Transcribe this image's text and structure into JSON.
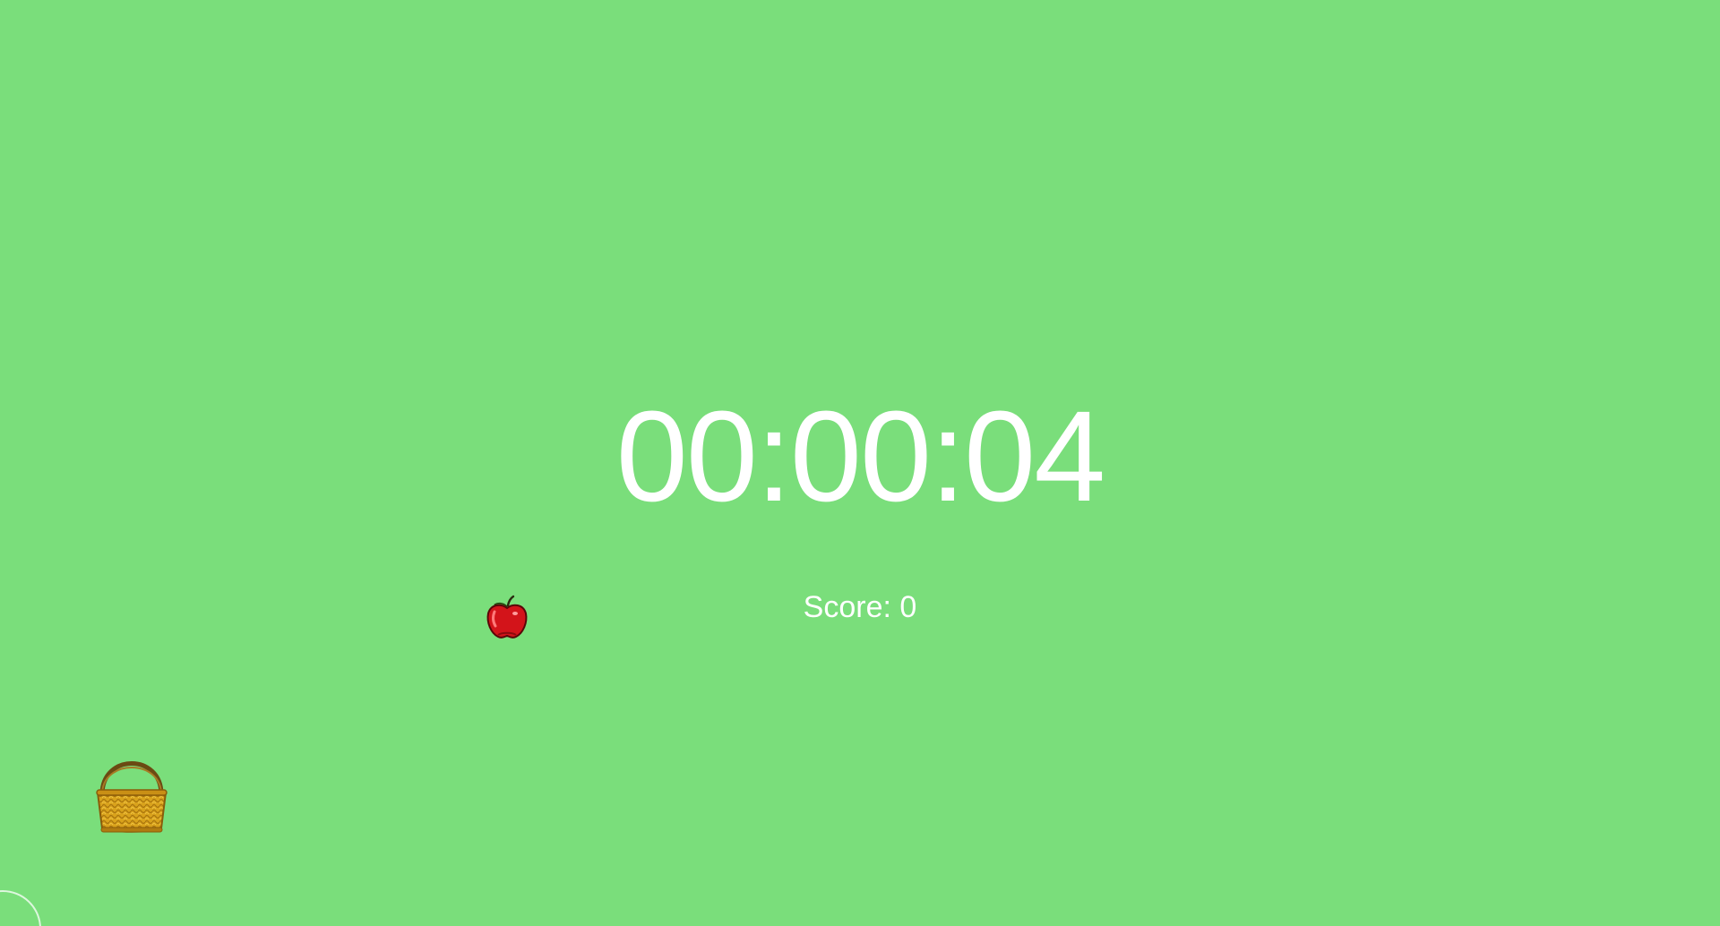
{
  "game": {
    "timer": "00:00:04",
    "score_label": "Score:",
    "score_value": "0"
  },
  "colors": {
    "background": "#7ade7b",
    "text": "#ffffff",
    "apple": "#d3141a",
    "basket": "#d9a21c",
    "basket_handle": "#6b4a12"
  },
  "icons": {
    "falling_item": "apple-icon",
    "player": "basket-icon",
    "corner": "touch-ring-icon"
  }
}
